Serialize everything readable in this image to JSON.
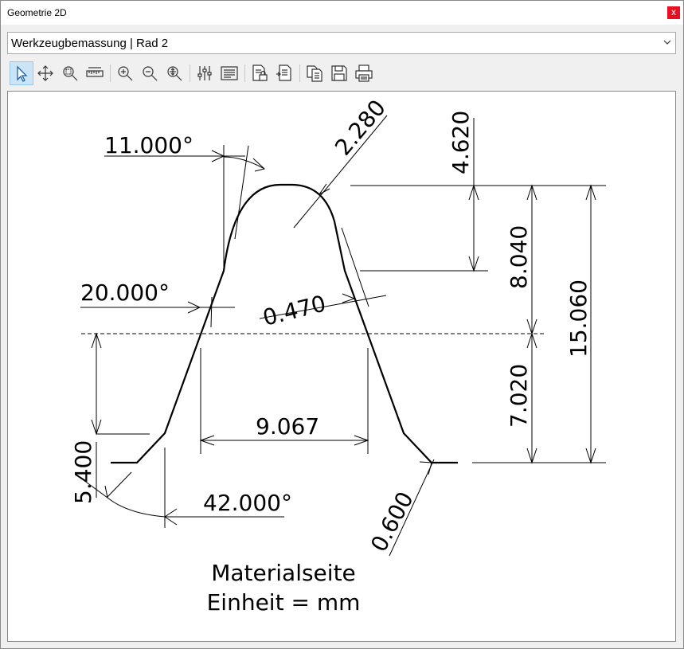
{
  "window": {
    "title": "Geometrie 2D",
    "close_glyph": "x"
  },
  "dropdown": {
    "value": "Werkzeugbemassung | Rad 2"
  },
  "toolbar": {
    "buttons": [
      {
        "name": "select",
        "icon": "pointer-icon",
        "active": true
      },
      {
        "name": "pan",
        "icon": "move-icon"
      },
      {
        "name": "zoom-window",
        "icon": "zoom-window-icon"
      },
      {
        "name": "measure",
        "icon": "ruler-icon"
      },
      {
        "name": "zoom-in",
        "icon": "zoom-in-icon"
      },
      {
        "name": "zoom-out",
        "icon": "zoom-out-icon"
      },
      {
        "name": "zoom-fit",
        "icon": "zoom-fit-icon"
      },
      {
        "name": "settings",
        "icon": "sliders-icon"
      },
      {
        "name": "text",
        "icon": "text-lines-icon"
      },
      {
        "name": "document-lock",
        "icon": "document-lock-icon"
      },
      {
        "name": "document-export",
        "icon": "document-export-icon"
      },
      {
        "name": "copy",
        "icon": "copy-icon"
      },
      {
        "name": "save",
        "icon": "save-icon"
      },
      {
        "name": "print",
        "icon": "print-icon"
      }
    ]
  },
  "drawing": {
    "dimensions": {
      "angle_tip": "11.000°",
      "radius_tip": "2.280",
      "height_upper": "4.620",
      "height_middle": "8.040",
      "height_total": "15.060",
      "angle_flank": "20.000°",
      "thickness": "0.470",
      "height_lower": "7.020",
      "width": "9.067",
      "depth_left": "5.400",
      "angle_base": "42.000°",
      "radius_base": "0.600"
    },
    "caption": {
      "line1": "Materialseite",
      "line2": "Einheit = mm"
    }
  }
}
